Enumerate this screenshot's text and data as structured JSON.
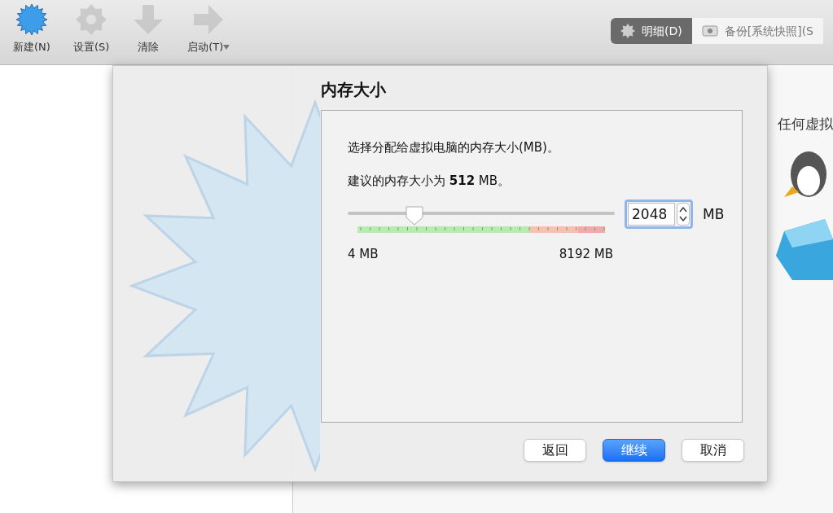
{
  "toolbar": [
    {
      "label": "新建(N)",
      "kind": "new",
      "disabled": false,
      "dropdown": false
    },
    {
      "label": "设置(S)",
      "kind": "settings",
      "disabled": true,
      "dropdown": false
    },
    {
      "label": "清除",
      "kind": "discard",
      "disabled": true,
      "dropdown": false
    },
    {
      "label": "启动(T)",
      "kind": "start",
      "disabled": true,
      "dropdown": true
    }
  ],
  "view_tabs": [
    {
      "label": "明细(D)",
      "kind": "details",
      "selected": true
    },
    {
      "label": "备份[系统快照](S",
      "kind": "snapshots",
      "selected": false
    }
  ],
  "background_text": "任何虚拟",
  "dialog": {
    "title": "内存大小",
    "description": "选择分配给虚拟电脑的内存大小(MB)。",
    "recommendation": "建议的内存大小为 **512** MB。",
    "slider": {
      "level": 0.25,
      "min_label": "4 MB",
      "max_label": "8192 MB"
    },
    "value": "2048",
    "unit": "MB",
    "buttons": [
      {
        "label": "返回",
        "primary": false
      },
      {
        "label": "继续",
        "primary": true
      },
      {
        "label": "取消",
        "primary": false
      }
    ]
  }
}
